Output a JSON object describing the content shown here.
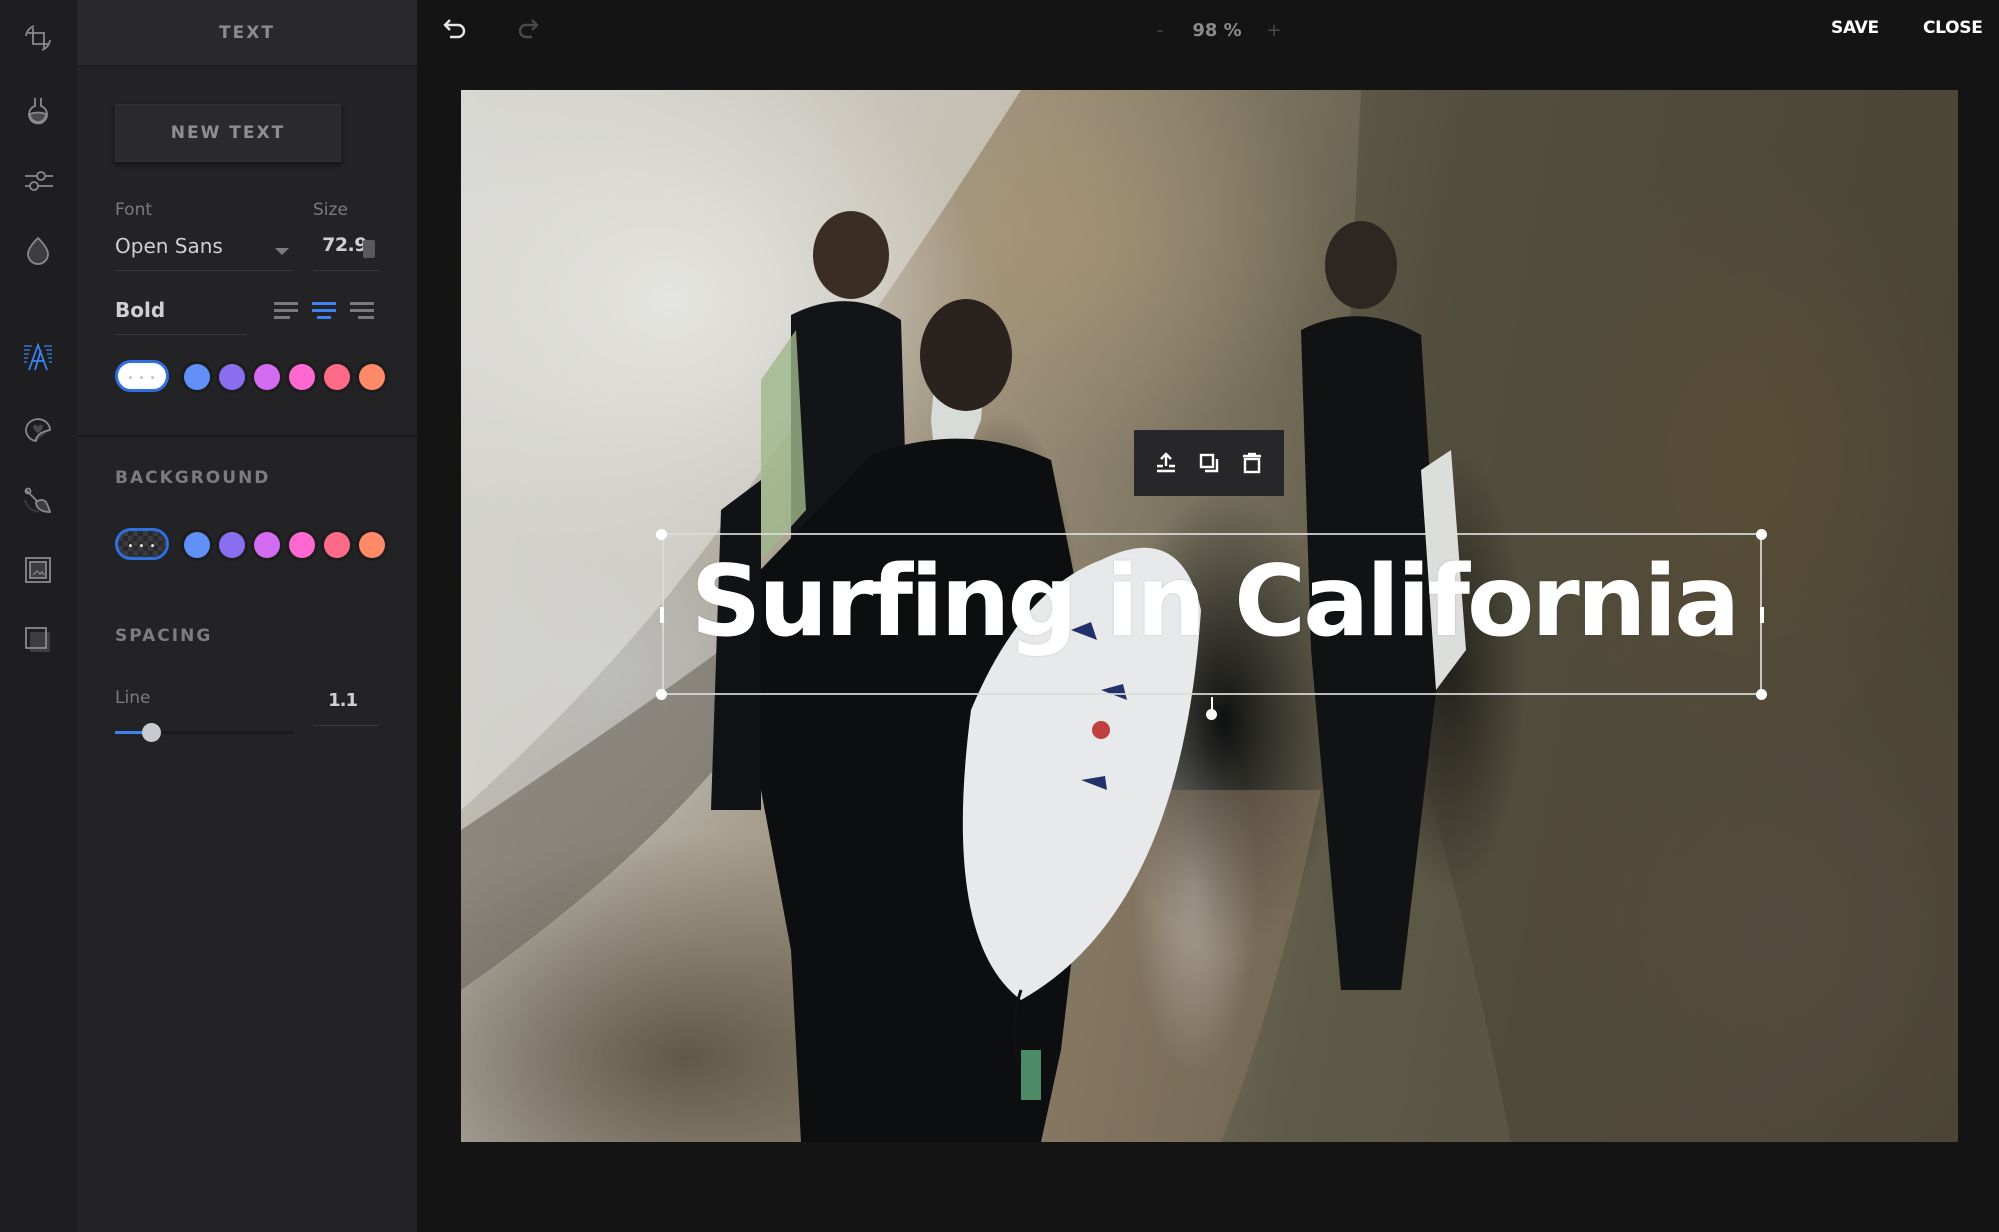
{
  "rail": {
    "items": [
      {
        "name": "crop-rotate",
        "active": false
      },
      {
        "name": "filter-flask",
        "active": false
      },
      {
        "name": "adjust-sliders",
        "active": false
      },
      {
        "name": "focus-drop",
        "active": false
      },
      {
        "name": "text",
        "active": true
      },
      {
        "name": "sticker",
        "active": false
      },
      {
        "name": "brush",
        "active": false
      },
      {
        "name": "frame",
        "active": false
      },
      {
        "name": "overlay",
        "active": false
      }
    ]
  },
  "panel": {
    "title": "TEXT",
    "new_text_label": "NEW TEXT",
    "font_label": "Font",
    "font_value": "Open Sans",
    "size_label": "Size",
    "size_value": "72.9",
    "weight_value": "Bold",
    "alignment": {
      "options": [
        "left",
        "center",
        "right"
      ],
      "selected": "center"
    },
    "text_colors": {
      "selected": "#ffffff",
      "swatches": [
        "#6090f8",
        "#8a6ef0",
        "#d46cf2",
        "#ff68d0",
        "#ff6a88",
        "#ff8a6a"
      ]
    },
    "background_title": "BACKGROUND",
    "background_colors": {
      "selected": "transparent",
      "swatches": [
        "#6090f8",
        "#8a6ef0",
        "#d46cf2",
        "#ff68d0",
        "#ff6a88",
        "#ff8a6a"
      ]
    },
    "spacing_title": "SPACING",
    "line_label": "Line",
    "line_value": "1.1",
    "line_slider_fraction": 0.2,
    "swatch_dots": "• • •"
  },
  "topbar": {
    "zoom_minus": "-",
    "zoom_value": "98 %",
    "zoom_plus": "+",
    "save_label": "SAVE",
    "close_label": "CLOSE"
  },
  "canvas": {
    "text_content": "Surfing in California",
    "object_toolbar": [
      "bring-to-front",
      "duplicate",
      "delete"
    ]
  },
  "colors": {
    "accent": "#3c82f0"
  }
}
